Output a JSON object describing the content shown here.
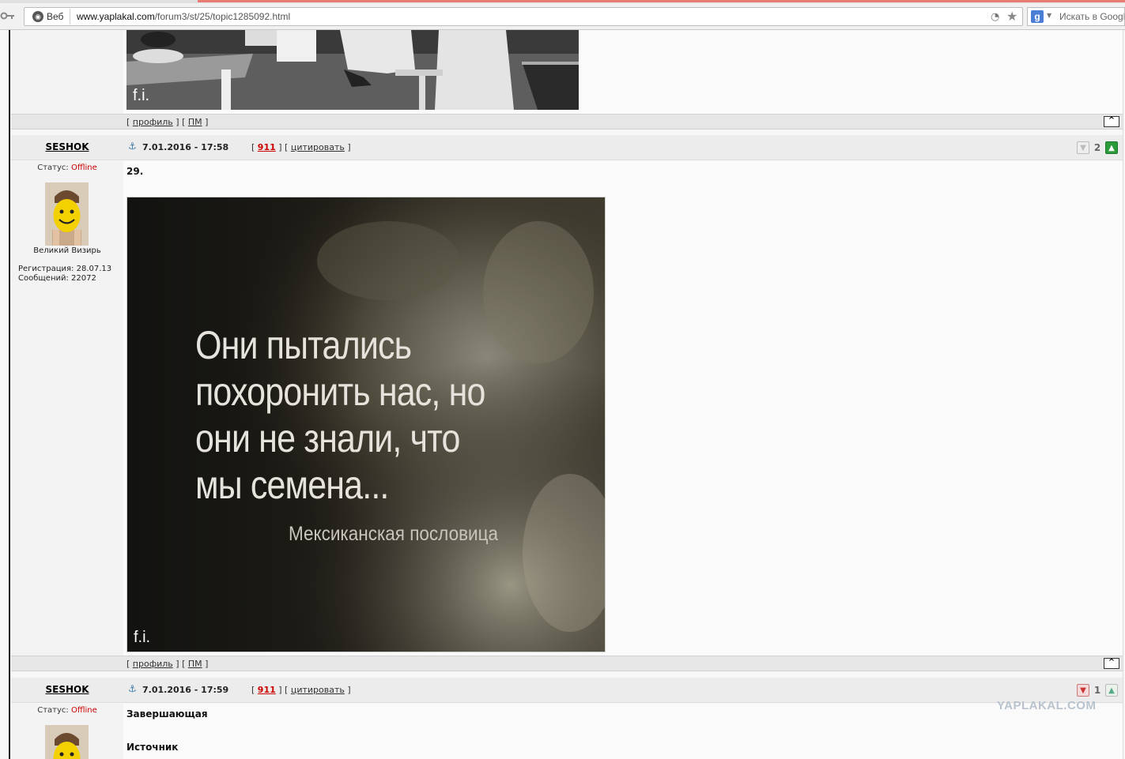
{
  "browser": {
    "tab_label": "Веб",
    "url_host": "www.yaplakal.com",
    "url_path": "/forum3/st/25/topic1285092.html",
    "search_placeholder": "Искать в Google"
  },
  "prev_post": {
    "image_watermark": "f.i.",
    "footer": {
      "profile": "профиль",
      "pm": "ПМ",
      "to_top": "^"
    }
  },
  "posts": [
    {
      "author": "SESHOK",
      "date": "7.01.2016 - 17:58",
      "number": "911",
      "quote_label": "цитировать",
      "status_label": "Статус: ",
      "status": "Offline",
      "rank": "Великий Визирь",
      "reg": "Регистрация: 28.07.13",
      "messages": "Сообщений: 22072",
      "rating": "2",
      "text": "29.",
      "image": {
        "quote_lines": [
          "Они пытались",
          "похоронить нас, но",
          "они не знали, что",
          "мы семена..."
        ],
        "attribution": "Мексиканская пословица",
        "watermark": "f.i."
      },
      "footer": {
        "profile": "профиль",
        "pm": "ПМ",
        "to_top": "^"
      }
    },
    {
      "author": "SESHOK",
      "date": "7.01.2016 - 17:59",
      "number": "911",
      "quote_label": "цитировать",
      "status_label": "Статус: ",
      "status": "Offline",
      "rating": "1",
      "text1": "Завершающая",
      "text2": "Источник"
    }
  ],
  "site_watermark": "YAPLAKAL.COM"
}
